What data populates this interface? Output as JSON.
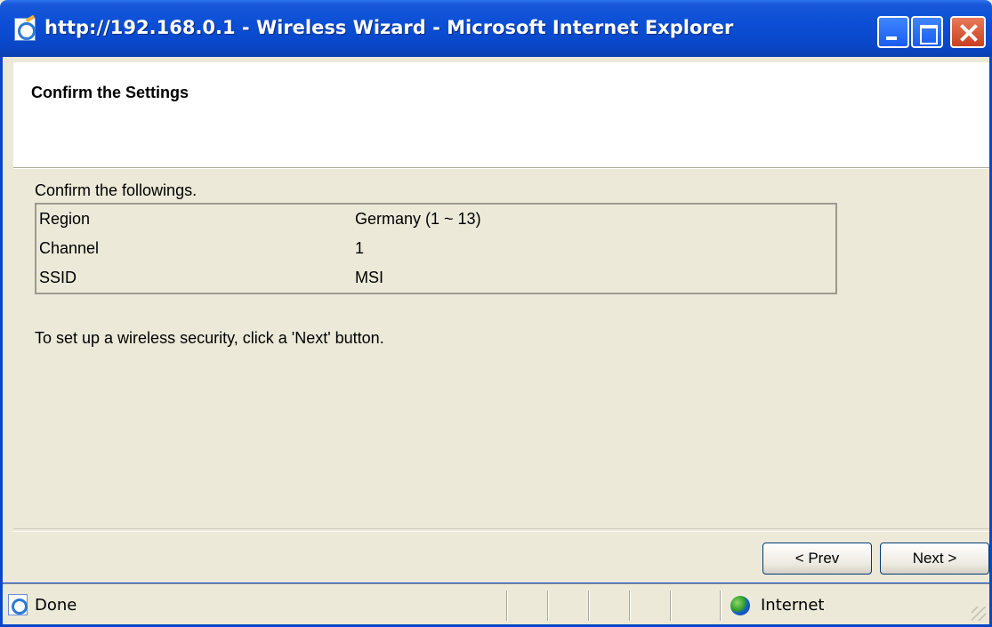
{
  "window": {
    "title": "http://192.168.0.1 - Wireless Wizard - Microsoft Internet Explorer"
  },
  "page": {
    "heading": "Confirm the Settings",
    "intro": "Confirm the followings.",
    "settings": [
      {
        "label": "Region",
        "value": "Germany (1 ~ 13)"
      },
      {
        "label": "Channel",
        "value": "1"
      },
      {
        "label": "SSID",
        "value": "MSI"
      }
    ],
    "note": "To set up a wireless security, click a 'Next' button."
  },
  "buttons": {
    "prev": "< Prev",
    "next": "Next >"
  },
  "statusbar": {
    "status": "Done",
    "zone": "Internet"
  },
  "colors": {
    "titlebar": "#0b4fd6",
    "close_button": "#c9401f",
    "dialog_bg": "#ece9d8"
  },
  "icons": [
    "ie-page-icon",
    "minimize-icon",
    "maximize-icon",
    "close-icon",
    "globe-icon"
  ]
}
